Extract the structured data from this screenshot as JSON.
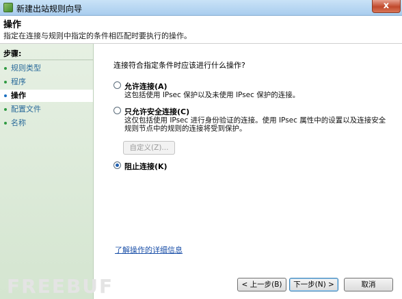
{
  "window": {
    "title": "新建出站规则向导",
    "close_glyph": "x"
  },
  "header": {
    "title": "操作",
    "description": "指定在连接与规则中指定的条件相匹配时要执行的操作。"
  },
  "sidebar": {
    "steps_label": "步骤:",
    "items": [
      {
        "label": "规则类型",
        "active": false
      },
      {
        "label": "程序",
        "active": false
      },
      {
        "label": "操作",
        "active": true
      },
      {
        "label": "配置文件",
        "active": false
      },
      {
        "label": "名称",
        "active": false
      }
    ]
  },
  "main": {
    "question": "连接符合指定条件时应该进行什么操作?",
    "options": [
      {
        "label": "允许连接(A)",
        "description": "这包括使用 IPsec 保护以及未使用 IPsec 保护的连接。",
        "checked": false
      },
      {
        "label": "只允许安全连接(C)",
        "description": "这仅包括使用 IPsec 进行身份验证的连接。使用 IPsec 属性中的设置以及连接安全规则节点中的规则的连接将受到保护。",
        "checked": false
      },
      {
        "label": "阻止连接(K)",
        "description": "",
        "checked": true
      }
    ],
    "customize_label": "自定义(Z)...",
    "help_link": "了解操作的详细信息"
  },
  "footer": {
    "back_label": "< 上一步(B)",
    "next_label": "下一步(N) >",
    "cancel_label": "取消"
  },
  "watermark": "FREEBUF",
  "colors": {
    "titlebar": "#a9cdee",
    "sidebar_bg": "#d4e5d0",
    "link": "#1a4fa8",
    "radio_checked": "#1f5fb0"
  }
}
